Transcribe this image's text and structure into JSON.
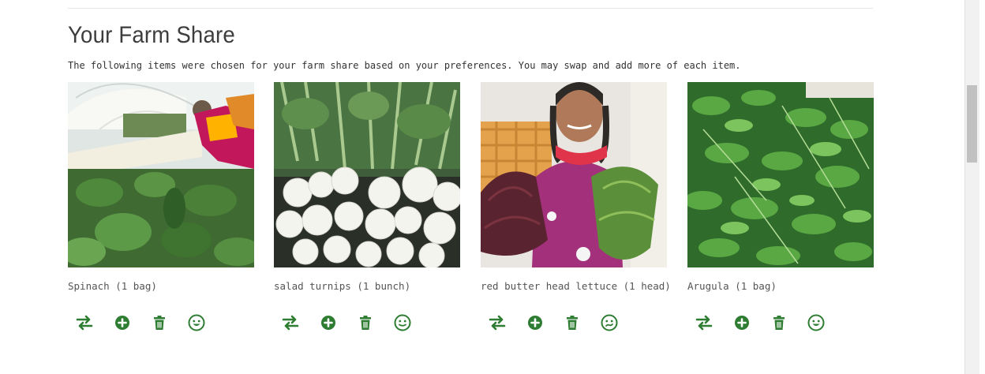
{
  "page": {
    "title": "Your Farm Share",
    "intro": "The following items were chosen for your farm share based on your preferences. You may swap and add more of each item."
  },
  "items": [
    {
      "label": "Spinach (1 bag)",
      "photo": "spinach-photo",
      "mood_icon": "happy-face-icon"
    },
    {
      "label": "salad turnips (1 bunch)",
      "photo": "turnips-photo",
      "mood_icon": "neutral-face-icon"
    },
    {
      "label": "red butter head lettuce (1 head)",
      "photo": "lettuce-photo",
      "mood_icon": "unsure-face-icon"
    },
    {
      "label": "Arugula (1 bag)",
      "photo": "arugula-photo",
      "mood_icon": "happy-face-icon"
    }
  ],
  "icons": {
    "swap": "swap-icon",
    "add": "add-circle-icon",
    "delete": "trash-icon"
  },
  "colors": {
    "accent": "#2e7d32",
    "title": "#3d3d3d",
    "label": "#555555"
  }
}
